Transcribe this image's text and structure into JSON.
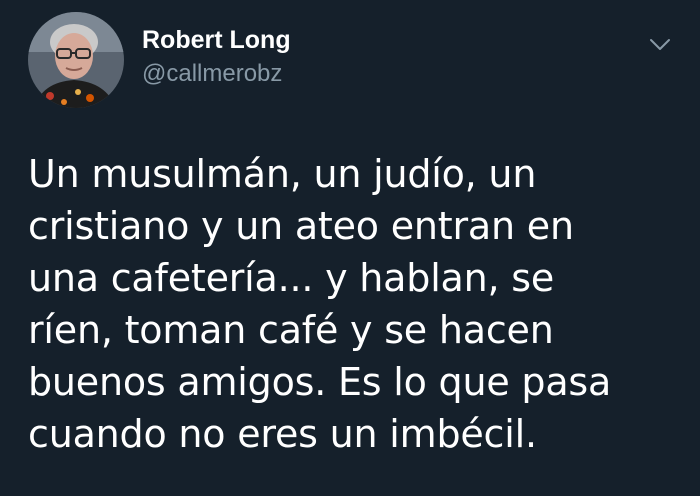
{
  "tweet": {
    "author_name": "Robert Long",
    "author_handle": "@callmerobz",
    "avatar_icon": "user-avatar",
    "menu_icon": "chevron-down-icon",
    "text_lines": [
      "Un musulmán, un judío, un",
      "cristiano y un ateo entran en",
      "una cafetería... y hablan, se",
      "ríen, toman café y se hacen",
      "buenos amigos. Es lo que pasa",
      "cuando no eres un imbécil."
    ]
  },
  "colors": {
    "background": "#15202b",
    "text": "#ffffff",
    "secondary_text": "#8899a6"
  }
}
